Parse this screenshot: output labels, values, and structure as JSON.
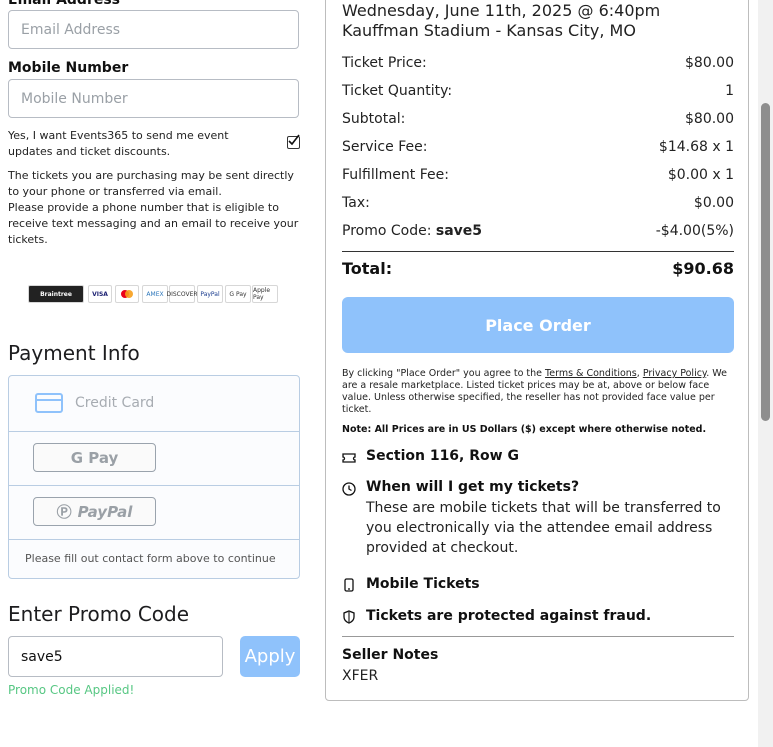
{
  "contact": {
    "email_label": "Email Address",
    "email_placeholder": "Email Address",
    "mobile_label": "Mobile Number",
    "mobile_placeholder": "Mobile Number",
    "opt_in_text": "Yes, I want Events365 to send me event updates and ticket discounts.",
    "opt_in_checked": true,
    "notice": "The tickets you are purchasing may be sent directly to your phone or transferred via email.\nPlease provide a phone number that is eligible to receive text messaging and an email to receive your tickets."
  },
  "payment_logos": [
    "Braintree",
    "VISA",
    "Mastercard",
    "AMEX",
    "DISCOVER",
    "PayPal",
    "G Pay",
    "Apple Pay"
  ],
  "payment": {
    "title": "Payment Info",
    "credit_card_label": "Credit Card",
    "gpay_label": "G Pay",
    "paypal_label": "PayPal",
    "footer_text": "Please fill out contact form above to continue"
  },
  "promo": {
    "title": "Enter Promo Code",
    "value": "save5",
    "apply_label": "Apply",
    "status": "Promo Code Applied!"
  },
  "event": {
    "datetime": "Wednesday, June 11th, 2025 @ 6:40pm",
    "venue": "Kauffman Stadium - Kansas City, MO"
  },
  "summary": {
    "rows": [
      {
        "label": "Ticket Price:",
        "value": "$80.00"
      },
      {
        "label": "Ticket Quantity:",
        "value": "1"
      },
      {
        "label": "Subtotal:",
        "value": "$80.00"
      },
      {
        "label": "Service Fee:",
        "value": "$14.68 x 1"
      },
      {
        "label": "Fulfillment Fee:",
        "value": "$0.00 x 1"
      },
      {
        "label": "Tax:",
        "value": "$0.00"
      }
    ],
    "promo_label": "Promo Code:",
    "promo_code": "save5",
    "promo_value": "-$4.00(5%)",
    "total_label": "Total:",
    "total_value": "$90.68"
  },
  "order": {
    "place_order_label": "Place Order",
    "terms_prefix": "By clicking \"Place Order\" you agree to the",
    "terms_link": "Terms & Conditions",
    "privacy_link": "Privacy Policy",
    "terms_suffix": "We are a resale marketplace. Listed ticket prices may be at, above or below face value. Unless otherwise specified, the reseller has not provided face value per ticket.",
    "note": "Note: All Prices are in US Dollars ($) except where otherwise noted."
  },
  "features": {
    "section": "Section 116, Row G",
    "when_title": "When will I get my tickets?",
    "when_text": "These are mobile tickets that will be transferred to you electronically via the attendee email address provided at checkout.",
    "mobile": "Mobile Tickets",
    "protected": "Tickets are protected against fraud."
  },
  "seller": {
    "title": "Seller Notes",
    "text": "XFER"
  },
  "colors": {
    "accent": "#8fc2fb",
    "success": "#57c783",
    "border": "#b9cde3"
  }
}
